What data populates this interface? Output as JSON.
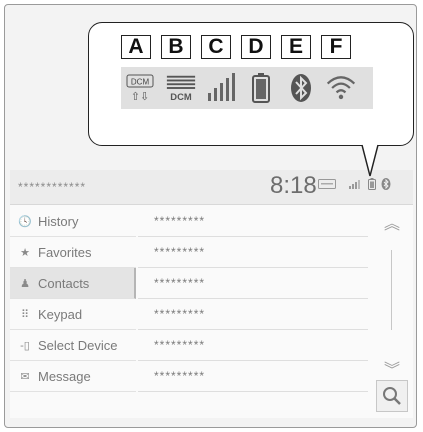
{
  "callout": {
    "labels": [
      "A",
      "B",
      "C",
      "D",
      "E",
      "F"
    ],
    "icons": [
      {
        "name": "dcm-transfer-icon",
        "text": "DCM",
        "arrows": "⇧⇩"
      },
      {
        "name": "dcm-signal-icon",
        "text": "DCM"
      },
      {
        "name": "cell-signal-icon"
      },
      {
        "name": "battery-icon"
      },
      {
        "name": "bluetooth-icon"
      },
      {
        "name": "wifi-icon"
      }
    ]
  },
  "status_bar": {
    "device_name": "************",
    "time": "8:18",
    "icons": [
      "dcm-icon",
      "signal-icon",
      "battery-icon",
      "bluetooth-icon"
    ]
  },
  "sidebar": {
    "items": [
      {
        "label": "History",
        "icon": "clock-icon",
        "glyph": "🕓"
      },
      {
        "label": "Favorites",
        "icon": "star-icon",
        "glyph": "★"
      },
      {
        "label": "Contacts",
        "icon": "person-icon",
        "glyph": "♟"
      },
      {
        "label": "Keypad",
        "icon": "keypad-icon",
        "glyph": "⠿"
      },
      {
        "label": "Select Device",
        "icon": "phone-icon",
        "glyph": "-▯"
      },
      {
        "label": "Message",
        "icon": "envelope-icon",
        "glyph": "✉"
      }
    ],
    "active_index": 2
  },
  "list": {
    "rows": [
      "*********",
      "*********",
      "*********",
      "*********",
      "*********",
      "*********"
    ]
  },
  "scroll": {
    "up": "︽",
    "down": "︾"
  },
  "search_icon": "search-icon"
}
